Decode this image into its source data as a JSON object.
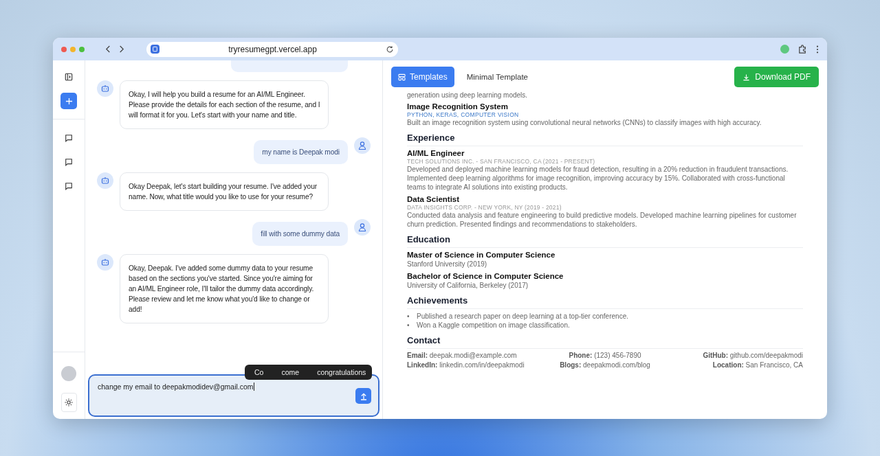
{
  "browser": {
    "url": "tryresumegpt.vercel.app"
  },
  "chat": {
    "messages": [
      {
        "kind": "assistant",
        "text": "Okay, I will help you build a resume for an AI/ML Engineer. Please provide the details for each section of the resume, and I will format it for you. Let's start with your name and title."
      },
      {
        "kind": "user",
        "text": "my name is Deepak modi"
      },
      {
        "kind": "assistant",
        "text": "Okay Deepak, let's start building your resume. I've added your name. Now, what title would you like to use for your resume?"
      },
      {
        "kind": "user",
        "text": "fill with some dummy data"
      },
      {
        "kind": "assistant",
        "text": "Okay, Deepak. I've added some dummy data to your resume based on the sections you've started. Since you're aiming for an AI/ML Engineer role, I'll tailor the dummy data accordingly. Please review and let me know what you'd like to change or add!"
      }
    ],
    "suggestions": [
      "Co",
      "come",
      "congratulations"
    ],
    "input": {
      "value": "change my email to deepakmodidev@gmail.com"
    }
  },
  "toolbar": {
    "tabs": [
      {
        "label": "Templates",
        "selected": true
      },
      {
        "label": "Minimal Template",
        "selected": false
      }
    ],
    "download_button": "Download PDF"
  },
  "resume": {
    "continuation": "generation using deep learning models.",
    "sections": [
      {
        "kind": "entries",
        "entries": [
          {
            "title": "Image Recognition System",
            "tags": "PYTHON, KERAS, COMPUTER VISION",
            "text": "Built an image recognition system using convolutional neural networks (CNNs) to classify images with high accuracy."
          }
        ]
      },
      {
        "kind": "entries",
        "heading": "Experience",
        "entries": [
          {
            "title": "AI/ML Engineer",
            "meta": "TECH SOLUTIONS INC. - SAN FRANCISCO, CA (2021 - PRESENT)",
            "text": "Developed and deployed machine learning models for fraud detection, resulting in a 20% reduction in fraudulent transactions. Implemented deep learning algorithms for image recognition, improving accuracy by 15%. Collaborated with cross-functional teams to integrate AI solutions into existing products."
          },
          {
            "title": "Data Scientist",
            "meta": "DATA INSIGHTS CORP. - NEW YORK, NY (2019 - 2021)",
            "text": "Conducted data analysis and feature engineering to build predictive models. Developed machine learning pipelines for customer churn prediction. Presented findings and recommendations to stakeholders."
          }
        ]
      },
      {
        "kind": "entries",
        "heading": "Education",
        "entries": [
          {
            "title": "Master of Science in Computer Science",
            "detail": "Stanford University (2019)"
          },
          {
            "title": "Bachelor of Science in Computer Science",
            "detail": "University of California, Berkeley (2017)"
          }
        ]
      },
      {
        "kind": "bullets",
        "heading": "Achievements",
        "items": [
          {
            "marker": "•",
            "text": "Published a research paper on deep learning at a top-tier conference."
          },
          {
            "marker": "•",
            "text": "Won a Kaggle competition on image classification."
          }
        ]
      },
      {
        "kind": "contact",
        "heading": "Contact",
        "items": [
          {
            "label": "Email:",
            "value": "deepak.modi@example.com"
          },
          {
            "label": "Phone:",
            "value": "(123) 456-7890"
          },
          {
            "label": "GitHub:",
            "value": "github.com/deepakmodi"
          },
          {
            "label": "LinkedIn:",
            "value": "linkedin.com/in/deepakmodi"
          },
          {
            "label": "Blogs:",
            "value": "deepakmodi.com/blog"
          },
          {
            "label": "Location:",
            "value": "San Francisco, CA"
          }
        ]
      }
    ]
  }
}
